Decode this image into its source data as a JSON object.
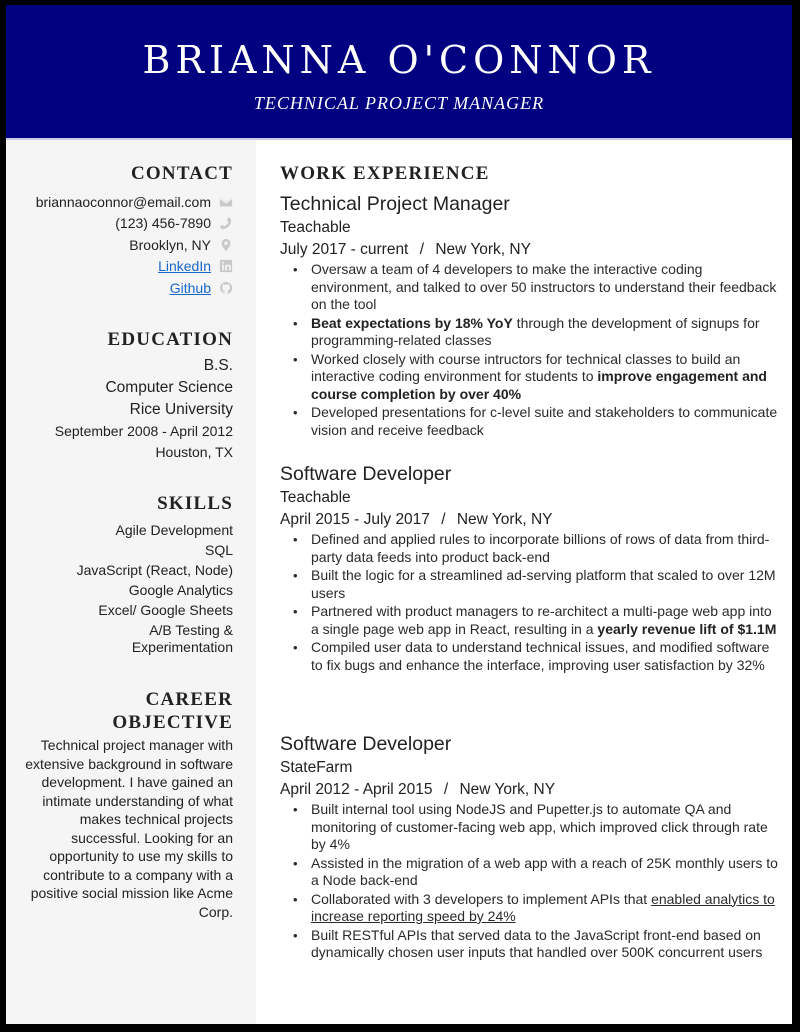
{
  "header": {
    "name": "BRIANNA O'CONNOR",
    "role": "TECHNICAL PROJECT MANAGER",
    "background_color": "#000080"
  },
  "sidebar": {
    "contact": {
      "title": "CONTACT",
      "items": [
        {
          "text": "briannaoconnor@email.com",
          "icon": "envelope-icon",
          "link": false
        },
        {
          "text": "(123) 456-7890",
          "icon": "phone-icon",
          "link": false
        },
        {
          "text": "Brooklyn, NY",
          "icon": "map-pin-icon",
          "link": true,
          "is_link": false
        },
        {
          "text": "LinkedIn",
          "icon": "linkedin-icon",
          "link": true
        },
        {
          "text": "Github",
          "icon": "github-icon",
          "link": true
        }
      ]
    },
    "education": {
      "title": "EDUCATION",
      "degree": "B.S.",
      "field": "Computer Science",
      "school": "Rice University",
      "dates": "September 2008 - April 2012",
      "location": "Houston, TX"
    },
    "skills": {
      "title": "SKILLS",
      "items": [
        "Agile Development",
        "SQL",
        "JavaScript (React, Node)",
        "Google Analytics",
        "Excel/ Google Sheets",
        "A/B Testing &",
        "Experimentation"
      ]
    },
    "objective": {
      "title_line1": "CAREER",
      "title_line2": "OBJECTIVE",
      "text": "Technical project manager with extensive background in software development. I have gained an intimate understanding of what makes technical projects successful. Looking for an opportunity to use my skills to contribute to a company with a positive social mission like Acme Corp."
    }
  },
  "main": {
    "title": "WORK EXPERIENCE",
    "jobs": [
      {
        "title": "Technical Project Manager",
        "company": "Teachable",
        "dates": "July 2017 - current",
        "separator": "/",
        "location": "New York, NY",
        "bullets": [
          [
            {
              "t": "Oversaw a team of 4 developers to make the interactive coding environment, and talked to over 50 instructors to understand their feedback on the tool",
              "s": "normal"
            }
          ],
          [
            {
              "t": "Beat expectations by 18% YoY",
              "s": "bold"
            },
            {
              "t": " through the development of signups for programming-related classes",
              "s": "normal"
            }
          ],
          [
            {
              "t": "Worked closely with course intructors for technical classes to build an interactive coding environment for students to ",
              "s": "normal"
            },
            {
              "t": "improve engagement and course completion by over 40%",
              "s": "bold"
            }
          ],
          [
            {
              "t": "Developed presentations for c-level suite and stakeholders to communicate vision and receive feedback",
              "s": "normal"
            }
          ]
        ]
      },
      {
        "title": "Software Developer",
        "company": "Teachable",
        "dates": "April 2015 - July 2017",
        "separator": "/",
        "location": "New York, NY",
        "bullets": [
          [
            {
              "t": "Defined and applied rules to incorporate billions of rows of data from third-party data feeds into product back-end",
              "s": "normal"
            }
          ],
          [
            {
              "t": "Built the logic for a streamlined ad-serving platform that scaled to over 12M users",
              "s": "normal"
            }
          ],
          [
            {
              "t": "Partnered with product managers to re-architect a multi-page web app into a single page web app in React, resulting in a ",
              "s": "normal"
            },
            {
              "t": "yearly revenue lift of $1.1M",
              "s": "bold"
            }
          ],
          [
            {
              "t": "Compiled user data to understand technical issues, and modified software to fix bugs and enhance the interface, improving user satisfaction by 32%",
              "s": "normal"
            }
          ]
        ]
      },
      {
        "title": "Software Developer",
        "company": "StateFarm",
        "dates": "April 2012 - April 2015",
        "separator": "/",
        "location": "New York, NY",
        "bullets": [
          [
            {
              "t": "Built internal tool using NodeJS and Pupetter.js to automate QA and monitoring of customer-facing web app, which improved click through rate by 4%",
              "s": "normal"
            }
          ],
          [
            {
              "t": "Assisted in the migration of a web app with a reach of 25K monthly users to a Node back-end",
              "s": "normal"
            }
          ],
          [
            {
              "t": "Collaborated with 3 developers to implement APIs that ",
              "s": "normal"
            },
            {
              "t": "enabled analytics to increase reporting speed by 24%",
              "s": "underline"
            }
          ],
          [
            {
              "t": "Built RESTful APIs that served data to the JavaScript front-end based on dynamically chosen user inputs that handled over 500K concurrent users",
              "s": "normal"
            }
          ]
        ]
      }
    ]
  }
}
